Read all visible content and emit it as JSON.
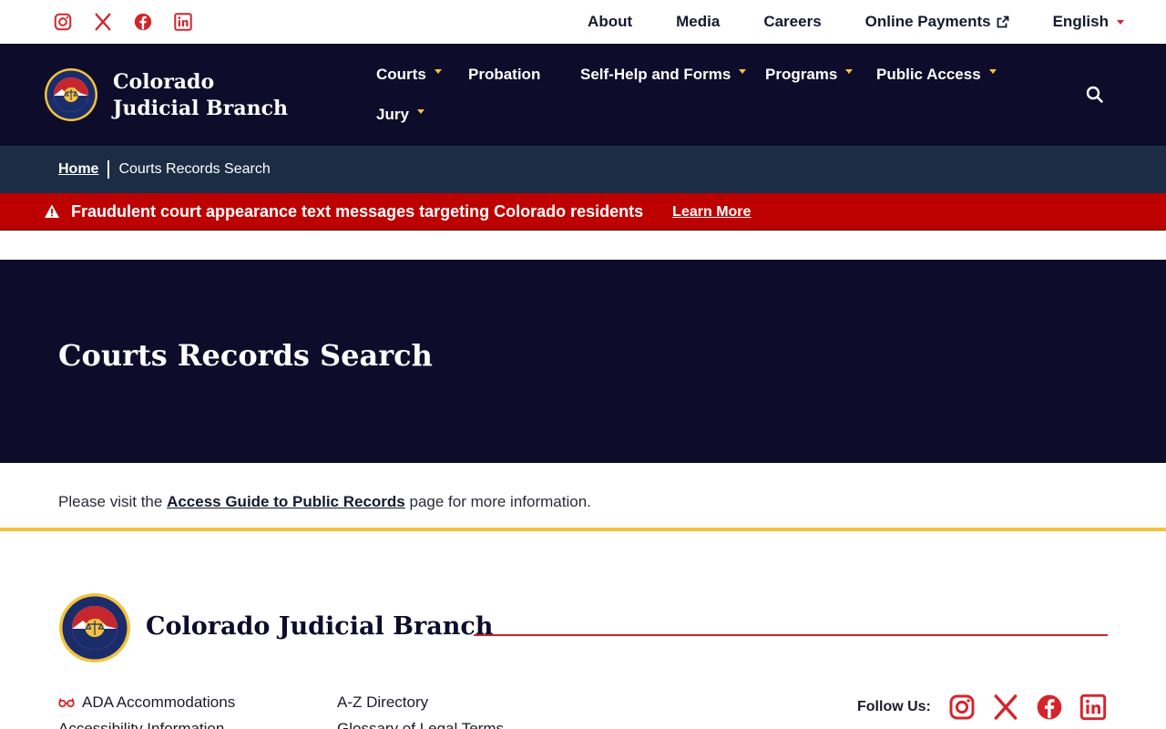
{
  "colors": {
    "navy": "#0e0c2b",
    "breadcrumb_bg": "#1b2c44",
    "alert_red": "#bd0000",
    "accent_red": "#d4252c",
    "gold": "#f5c33b"
  },
  "utility": {
    "social": [
      {
        "name": "instagram-icon"
      },
      {
        "name": "x-icon"
      },
      {
        "name": "facebook-icon"
      },
      {
        "name": "linkedin-icon"
      }
    ],
    "links": {
      "about": "About",
      "media": "Media",
      "careers": "Careers",
      "payments": "Online Payments",
      "language": "English"
    }
  },
  "nav": {
    "site_name": "Colorado Judicial Branch",
    "items": {
      "courts": "Courts",
      "probation": "Probation",
      "selfhelp": "Self-Help and Forms",
      "programs": "Programs",
      "public_access": "Public Access",
      "jury": "Jury"
    }
  },
  "breadcrumb": {
    "home": "Home",
    "current": "Courts Records Search"
  },
  "alert": {
    "text": "Fraudulent court appearance text messages targeting Colorado residents",
    "link": "Learn More"
  },
  "hero": {
    "title": "Courts Records Search"
  },
  "content": {
    "before": "Please visit the ",
    "link": "Access Guide to Public Records",
    "after": " page for more information."
  },
  "footer": {
    "name": "Colorado Judicial Branch",
    "ada": "ADA Accommodations",
    "accessibility": "Accessibility Information",
    "az": "A-Z Directory",
    "glossary": "Glossary of Legal Terms",
    "follow": "Follow Us:"
  }
}
